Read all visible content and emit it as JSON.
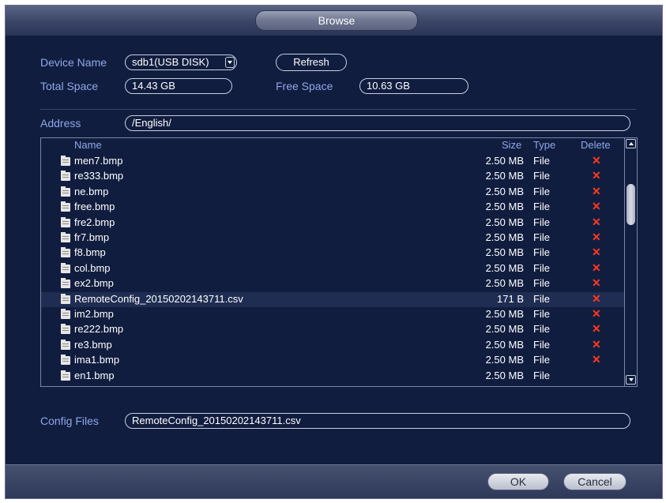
{
  "window": {
    "title": "Browse"
  },
  "device": {
    "name_label": "Device Name",
    "name_value": "sdb1(USB DISK)",
    "refresh_label": "Refresh",
    "total_label": "Total Space",
    "total_value": "14.43 GB",
    "free_label": "Free Space",
    "free_value": "10.63 GB"
  },
  "address": {
    "label": "Address",
    "value": "/English/"
  },
  "file_list": {
    "columns": [
      "Name",
      "Size",
      "Type",
      "Delete"
    ],
    "rows": [
      {
        "name": "men7.bmp",
        "size": "2.50 MB",
        "type": "File",
        "delete": "✕"
      },
      {
        "name": "re333.bmp",
        "size": "2.50 MB",
        "type": "File",
        "delete": "✕"
      },
      {
        "name": "ne.bmp",
        "size": "2.50 MB",
        "type": "File",
        "delete": "✕"
      },
      {
        "name": "free.bmp",
        "size": "2.50 MB",
        "type": "File",
        "delete": "✕"
      },
      {
        "name": "fre2.bmp",
        "size": "2.50 MB",
        "type": "File",
        "delete": "✕"
      },
      {
        "name": "fr7.bmp",
        "size": "2.50 MB",
        "type": "File",
        "delete": "✕"
      },
      {
        "name": "f8.bmp",
        "size": "2.50 MB",
        "type": "File",
        "delete": "✕"
      },
      {
        "name": "col.bmp",
        "size": "2.50 MB",
        "type": "File",
        "delete": "✕"
      },
      {
        "name": "ex2.bmp",
        "size": "2.50 MB",
        "type": "File",
        "delete": "✕"
      },
      {
        "name": "RemoteConfig_20150202143711.csv",
        "size": "171 B",
        "type": "File",
        "delete": "✕"
      },
      {
        "name": "im2.bmp",
        "size": "2.50 MB",
        "type": "File",
        "delete": "✕"
      },
      {
        "name": "re222.bmp",
        "size": "2.50 MB",
        "type": "File",
        "delete": "✕"
      },
      {
        "name": "re3.bmp",
        "size": "2.50 MB",
        "type": "File",
        "delete": "✕"
      },
      {
        "name": "ima1.bmp",
        "size": "2.50 MB",
        "type": "File",
        "delete": "✕"
      },
      {
        "name": "en1.bmp",
        "size": "2.50 MB",
        "type": "File",
        "delete": ""
      }
    ],
    "selected_index": 9
  },
  "config": {
    "label": "Config Files",
    "value": "RemoteConfig_20150202143711.csv"
  },
  "footer": {
    "ok_label": "OK",
    "cancel_label": "Cancel"
  },
  "colors": {
    "background": "#111d3f",
    "label": "#8ea8e8",
    "delete_icon": "#ff3a1f",
    "selected_row": "#1f2d52"
  }
}
